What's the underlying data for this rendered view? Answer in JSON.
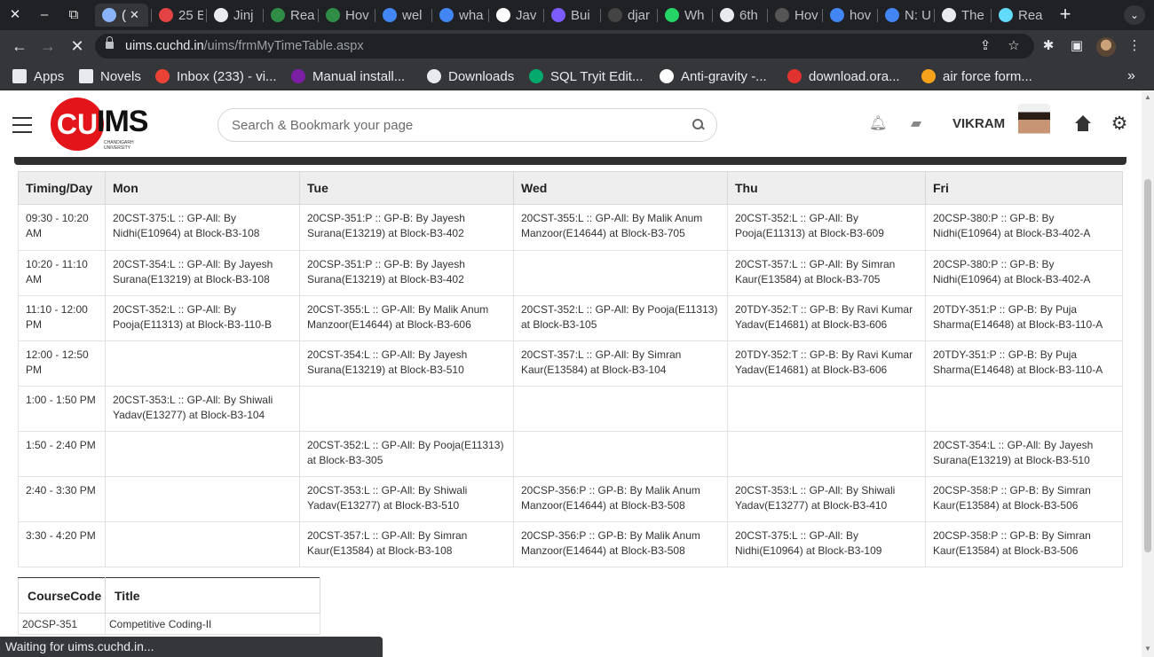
{
  "browser": {
    "tabs": [
      {
        "title": "(",
        "icon": "loading-icon",
        "color": "#8ab4f8",
        "active": true
      },
      {
        "title": "25 E",
        "icon": "shield-icon",
        "color": "#e34343"
      },
      {
        "title": "Jinj",
        "icon": "web-icon",
        "color": "#e8eaed"
      },
      {
        "title": "Rea",
        "icon": "geeksforgeeks-icon",
        "color": "#2f8d46"
      },
      {
        "title": "Hov",
        "icon": "geeksforgeeks-icon",
        "color": "#2f8d46"
      },
      {
        "title": "wel",
        "icon": "google-icon",
        "color": "#4285f4"
      },
      {
        "title": "wha",
        "icon": "google-icon",
        "color": "#4285f4"
      },
      {
        "title": "Jav",
        "icon": "medium-icon",
        "color": "#ffffff"
      },
      {
        "title": "Bui",
        "icon": "app-icon",
        "color": "#7c5cff"
      },
      {
        "title": "djar",
        "icon": "github-icon",
        "color": "#444444"
      },
      {
        "title": "Wh",
        "icon": "whatsapp-icon",
        "color": "#25d366"
      },
      {
        "title": "6th",
        "icon": "web-icon",
        "color": "#e8eaed"
      },
      {
        "title": "Hov",
        "icon": "hex-icon",
        "color": "#555555"
      },
      {
        "title": "hov",
        "icon": "google-icon",
        "color": "#4285f4"
      },
      {
        "title": "N: U",
        "icon": "google-icon",
        "color": "#4285f4"
      },
      {
        "title": "The",
        "icon": "web-icon",
        "color": "#e8eaed"
      },
      {
        "title": "Rea",
        "icon": "react-icon",
        "color": "#61dafb"
      }
    ],
    "url_host": "uims.cuchd.in",
    "url_path": "/uims/frmMyTimeTable.aspx",
    "bookmarks": [
      {
        "label": "Apps",
        "icon": "apps-grid-icon",
        "color": "#e8eaed"
      },
      {
        "label": "Novels",
        "icon": "folder-icon",
        "color": "#e8eaed"
      },
      {
        "label": "Inbox (233) - vi...",
        "icon": "gmail-icon",
        "color": "#ea4335"
      },
      {
        "label": "Manual install...",
        "icon": "inkbox-icon",
        "color": "#7b1fa2"
      },
      {
        "label": "Downloads",
        "icon": "download-icon",
        "color": "#e8eaed"
      },
      {
        "label": "SQL Tryit Edit...",
        "icon": "w3schools-icon",
        "color": "#04aa6d"
      },
      {
        "label": "Anti-gravity -...",
        "icon": "wikipedia-icon",
        "color": "#ffffff"
      },
      {
        "label": "download.ora...",
        "icon": "oracle-icon",
        "color": "#e0322f"
      },
      {
        "label": "air force form...",
        "icon": "airforce-icon",
        "color": "#f7a21b"
      }
    ],
    "status_text": "Waiting for uims.cuchd.in..."
  },
  "header": {
    "logo_text": "CU",
    "logo_ims": "IMS",
    "logo_sub": "CHANDIGARH UNIVERSITY",
    "search_placeholder": "Search & Bookmark your page",
    "username": "VIKRAM"
  },
  "timetable": {
    "headers": [
      "Timing/Day",
      "Mon",
      "Tue",
      "Wed",
      "Thu",
      "Fri"
    ],
    "rows": [
      [
        "09:30 - 10:20 AM",
        "20CST-375:L :: GP-All: By Nidhi(E10964) at Block-B3-108",
        "20CSP-351:P :: GP-B: By Jayesh Surana(E13219) at Block-B3-402",
        "20CST-355:L :: GP-All: By Malik Anum Manzoor(E14644) at Block-B3-705",
        "20CST-352:L :: GP-All: By Pooja(E11313) at Block-B3-609",
        "20CSP-380:P :: GP-B: By Nidhi(E10964) at Block-B3-402-A"
      ],
      [
        "10:20 - 11:10 AM",
        "20CST-354:L :: GP-All: By Jayesh Surana(E13219) at Block-B3-108",
        "20CSP-351:P :: GP-B: By Jayesh Surana(E13219) at Block-B3-402",
        "",
        "20CST-357:L :: GP-All: By Simran Kaur(E13584) at Block-B3-705",
        "20CSP-380:P :: GP-B: By Nidhi(E10964) at Block-B3-402-A"
      ],
      [
        "11:10 - 12:00 PM",
        "20CST-352:L :: GP-All: By Pooja(E11313) at Block-B3-110-B",
        "20CST-355:L :: GP-All: By Malik Anum Manzoor(E14644) at Block-B3-606",
        "20CST-352:L :: GP-All: By Pooja(E11313) at Block-B3-105",
        "20TDY-352:T :: GP-B: By Ravi Kumar Yadav(E14681) at Block-B3-606",
        "20TDY-351:P :: GP-B: By Puja Sharma(E14648) at Block-B3-110-A"
      ],
      [
        "12:00 - 12:50 PM",
        "",
        "20CST-354:L :: GP-All: By Jayesh Surana(E13219) at Block-B3-510",
        "20CST-357:L :: GP-All: By Simran Kaur(E13584) at Block-B3-104",
        "20TDY-352:T :: GP-B: By Ravi Kumar Yadav(E14681) at Block-B3-606",
        "20TDY-351:P :: GP-B: By Puja Sharma(E14648) at Block-B3-110-A"
      ],
      [
        "1:00 - 1:50 PM",
        "20CST-353:L :: GP-All: By Shiwali Yadav(E13277) at Block-B3-104",
        "",
        "",
        "",
        ""
      ],
      [
        "1:50 - 2:40 PM",
        "",
        "20CST-352:L :: GP-All: By Pooja(E11313) at Block-B3-305",
        "",
        "",
        "20CST-354:L :: GP-All: By Jayesh Surana(E13219) at Block-B3-510"
      ],
      [
        "2:40 - 3:30 PM",
        "",
        "20CST-353:L :: GP-All: By Shiwali Yadav(E13277) at Block-B3-510",
        "20CSP-356:P :: GP-B: By Malik Anum Manzoor(E14644) at Block-B3-508",
        "20CST-353:L :: GP-All: By Shiwali Yadav(E13277) at Block-B3-410",
        "20CSP-358:P :: GP-B: By Simran Kaur(E13584) at Block-B3-506"
      ],
      [
        "3:30 - 4:20 PM",
        "",
        "20CST-357:L :: GP-All: By Simran Kaur(E13584) at Block-B3-108",
        "20CSP-356:P :: GP-B: By Malik Anum Manzoor(E14644) at Block-B3-508",
        "20CST-375:L :: GP-All: By Nidhi(E10964) at Block-B3-109",
        "20CSP-358:P :: GP-B: By Simran Kaur(E13584) at Block-B3-506"
      ]
    ]
  },
  "courses": {
    "headers": [
      "CourseCode",
      "Title"
    ],
    "rows": [
      [
        "20CSP-351",
        "Competitive Coding-II"
      ]
    ]
  }
}
